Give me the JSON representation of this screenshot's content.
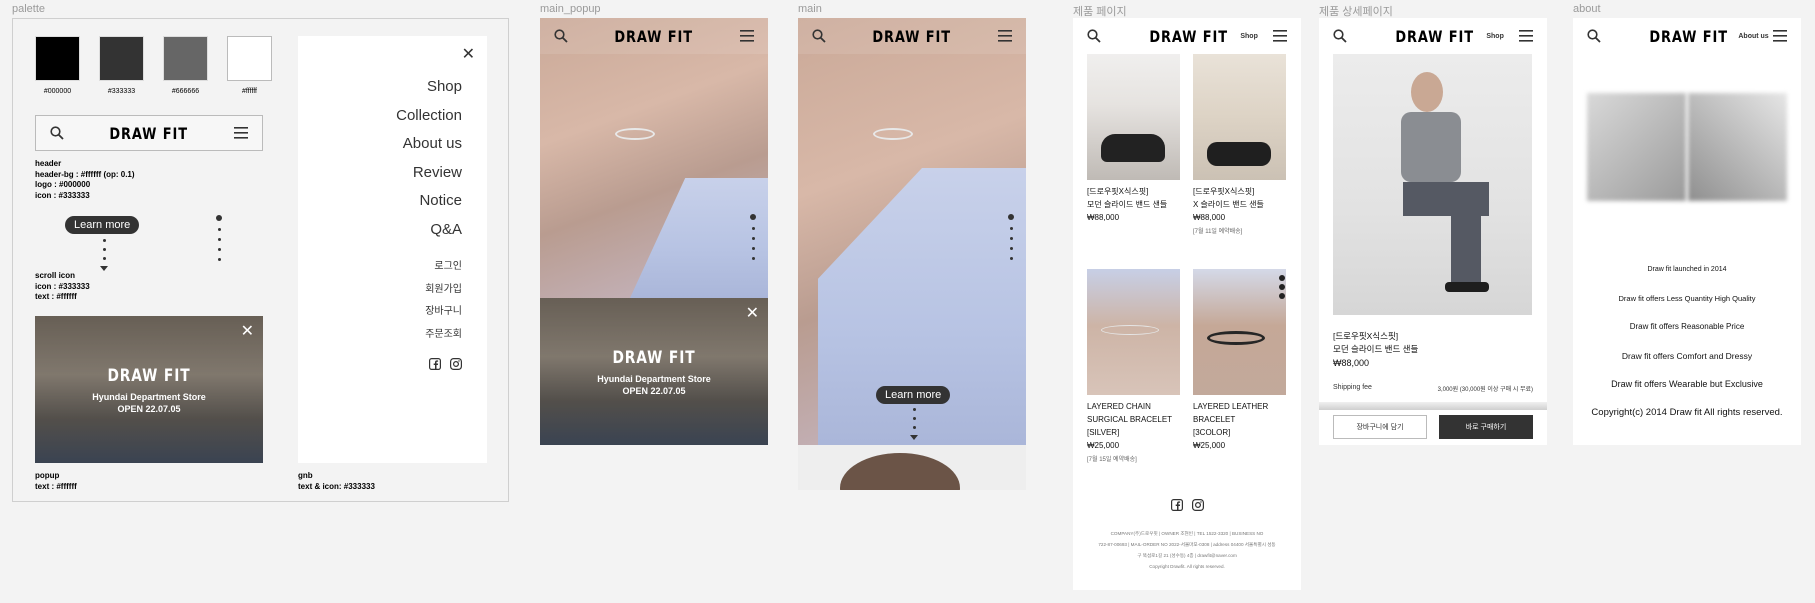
{
  "frames": {
    "palette": "palette",
    "main_popup": "main_popup",
    "main": "main",
    "product": "제품 페이지",
    "detail": "제품 상세페이지",
    "about": "about"
  },
  "brand": {
    "logo": "DRAW FIT"
  },
  "palette": {
    "swatches": [
      {
        "hex": "#000000",
        "label": "#000000"
      },
      {
        "hex": "#333333",
        "label": "#333333"
      },
      {
        "hex": "#666666",
        "label": "#666666"
      },
      {
        "hex": "#ffffff",
        "label": "#ffffff"
      }
    ],
    "header_notes": [
      "header",
      "header-bg : #ffffff (op: 0.1)",
      "logo : #000000",
      "icon : #333333"
    ],
    "learn_more": "Learn more",
    "scroll_notes": [
      "scroll icon",
      "icon : #333333",
      "text : #ffffff"
    ],
    "popup_notes": [
      "popup",
      "text : #ffffff"
    ],
    "gnb_notes": [
      "gnb",
      "text  & icon: #333333"
    ]
  },
  "popup": {
    "logo": "DRAW FIT",
    "line1": "Hyundai Department Store",
    "line2": "OPEN 22.07.05"
  },
  "gnb": {
    "menu": [
      "Shop",
      "Collection",
      "About us",
      "Review",
      "Notice",
      "Q&A"
    ],
    "account": [
      "로그인",
      "회원가입",
      "장바구니",
      "주문조회"
    ]
  },
  "main": {
    "learn_more": "Learn more"
  },
  "product_page": {
    "nav_label": "Shop",
    "items": [
      {
        "name": "[드로우핏X식스핏]\n모던 슬라이드 밴드 샌들",
        "price": "₩88,000",
        "note": ""
      },
      {
        "name": "[드로우핏X식스핏]\nX 슬라이드 밴드 샌들",
        "price": "₩88,000",
        "note": "[7월 11일 예약배송]"
      },
      {
        "name": "LAYERED CHAIN\nSURGICAL BRACELET\n[SILVER]",
        "price": "₩25,000",
        "note": "[7월 15일 예약배송]"
      },
      {
        "name": "LAYERED LEATHER\nBRACELET\n[3COLOR]",
        "price": "₩25,000",
        "note": ""
      }
    ],
    "footer": [
      "COMPANY(주)드로우핏 | OWNER 조현빈 | TEL 1522-3320 | BUSINESS NO",
      "722-87-00693 | MAIL-ORDER NO 2022-서울마포-0308 | address 04400 서울특별시 성동",
      "구 뚝섬로1길 21 (성수동) 4층 | drawfit@naver.com",
      "Copyright Drawfit. All rights reserved."
    ]
  },
  "detail_page": {
    "nav_label": "Shop",
    "name": "[드로우핏X식스핏]\n모던 슬라이드 밴드 샌들",
    "price": "₩88,000",
    "shipping_label": "Shipping fee",
    "shipping_value": "3,000원 (30,000원 이상 구매 시 무료)",
    "cart_button": "장바구니에 담기",
    "buy_button": "바로 구매하기"
  },
  "about_page": {
    "nav_label": "About us",
    "lines": [
      "Draw fit launched in 2014",
      "Draw fit offers Less Quantity High Quality",
      "Draw fit offers Reasonable Price",
      "Draw fit offers Comfort and Dressy",
      "Draw fit offers Wearable but Exclusive",
      "Copyright(c) 2014 Draw fit All rights reserved."
    ]
  }
}
